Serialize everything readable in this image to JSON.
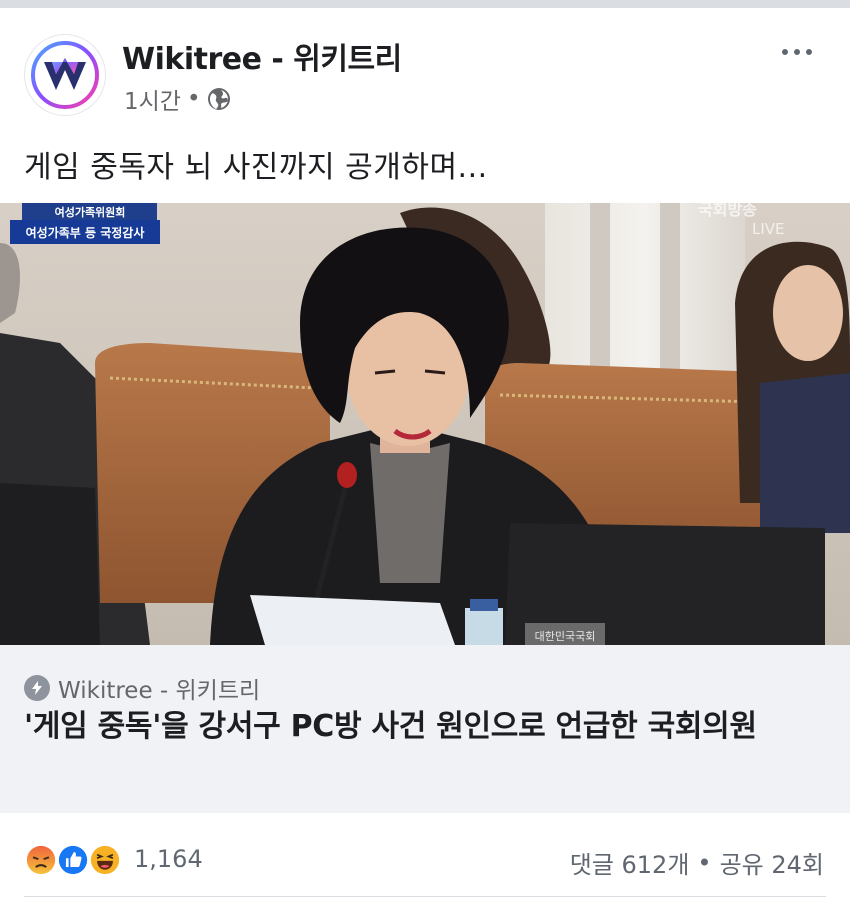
{
  "post": {
    "page_name": "Wikitree - 위키트리",
    "time": "1시간",
    "separator": "•",
    "privacy_icon": "globe-icon",
    "more_icon": "more-dots-icon",
    "text": "게임 중독자 뇌 사진까지 공개하며..."
  },
  "media": {
    "caption_top": "여성가족위원회",
    "caption_bottom": "여성가족부 등 국정감사",
    "broadcaster_watermark": "국회방송",
    "live_watermark": "LIVE",
    "nameplate": "대한민국국회"
  },
  "link": {
    "source": "Wikitree - 위키트리",
    "source_icon": "lightning-icon",
    "title": "'게임 중독'을 강서구 PC방 사건 원인으로 언급한 국회의원"
  },
  "reactions": {
    "icons": [
      "angry-icon",
      "like-icon",
      "haha-icon"
    ],
    "count": "1,164",
    "comments": "댓글 612개",
    "separator": "•",
    "shares": "공유 24회"
  },
  "colors": {
    "accent_blue": "#1877f2",
    "angry": "#f0643c",
    "haha": "#f7b125",
    "link_bg": "#f0f2f5",
    "secondary_text": "#65676b"
  }
}
